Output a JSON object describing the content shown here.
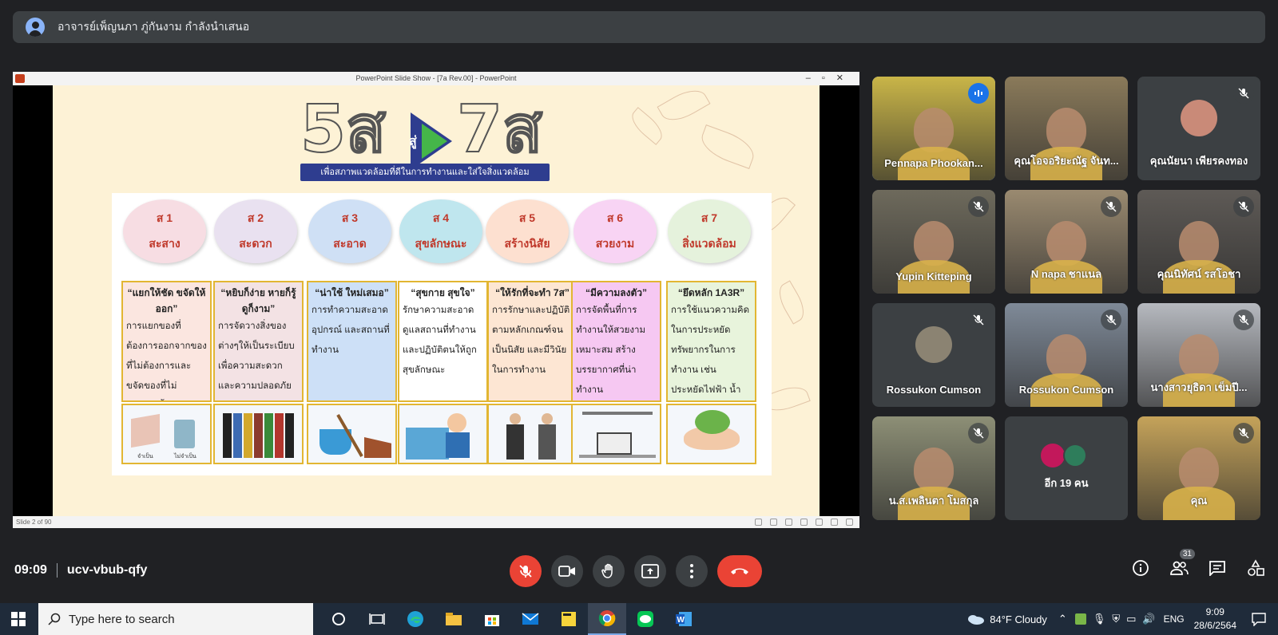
{
  "banner": {
    "text": "อาจารย์เพ็ญนภา ภู่กันงาม กำลังนำเสนอ"
  },
  "presentation": {
    "window_title": "PowerPoint Slide Show - [7a Rev.00] - PowerPoint",
    "status": "Slide 2 of 90",
    "slide": {
      "logo_left": "5ส",
      "logo_mid": "สู่",
      "logo_right": "7ส",
      "subtitle": "เพื่อสภาพแวดล้อมที่ดีในการทำงานและใส่ใจสิ่งแวดล้อม",
      "items": [
        {
          "num": "ส 1",
          "name": "สะสาง",
          "head": "“แยกให้ชัด ขจัดให้ออก”",
          "body": "การแยกของที่ต้องการออกจากของที่ไม่ต้องการและขจัดของที่ไม่ต้องการทิ้ง",
          "color": "#f7dde3",
          "cell": "#fbe6e0"
        },
        {
          "num": "ส 2",
          "name": "สะดวก",
          "head": "“หยิบก็ง่าย หายก็รู้ ดูก็งาม”",
          "body": "การจัดวางสิ่งของต่างๆให้เป็นระเบียบ เพื่อความสะดวกและความปลอดภัย",
          "color": "#e9e1f0",
          "cell": "#f3e2e4"
        },
        {
          "num": "ส 3",
          "name": "สะอาด",
          "head": "“น่าใช้ ใหม่เสมอ”",
          "body": "การทำความสะอาดอุปกรณ์ และสถานที่ทำงาน",
          "color": "#cfe0f5",
          "cell": "#cde0f7"
        },
        {
          "num": "ส 4",
          "name": "สุขลักษณะ",
          "head": "“สุขกาย สุขใจ”",
          "body": "รักษาความสะอาดดูแลสถานที่ทำงานและปฏิบัติตนให้ถูกสุขลักษณะ",
          "color": "#bfe6ee",
          "cell": "#fff"
        },
        {
          "num": "ส 5",
          "name": "สร้างนิสัย",
          "head": "“ให้รักที่จะทำ 7ส”",
          "body": "การรักษาและปฏิบัติตามหลักเกณฑ์จนเป็นนิสัย และมีวินัยในการทำงาน",
          "color": "#fde0d0",
          "cell": "#fde6d3"
        },
        {
          "num": "ส 6",
          "name": "สวยงาม",
          "head": "“มีความลงตัว”",
          "body": "การจัดพื้นที่การทำงานให้สวยงาม เหมาะสม สร้างบรรยากาศที่น่าทำงาน",
          "color": "#f8d4f4",
          "cell": "#f6c8f2"
        },
        {
          "num": "ส 7",
          "name": "สิ่งแวดล้อม",
          "head": "“ยึดหลัก 1A3R”",
          "body": "การใช้แนวความคิดในการประหยัดทรัพยากรในการทำงาน เช่น ประหยัดไฟฟ้า น้ำ กระดาษ",
          "color": "#e5f2dc",
          "cell": "#e8f4dc"
        }
      ],
      "pictures": [
        "จำเป็น",
        "ไม่จำเป็น"
      ]
    }
  },
  "participants": [
    {
      "name": "Pennapa Phookan...",
      "type": "video",
      "speaking": true,
      "bg": "#c9b548"
    },
    {
      "name": "คุณโอจอริยะณัฐ จันท...",
      "type": "video",
      "bg": "#8a7a5a"
    },
    {
      "name": "คุณนัยนา เพียรคงทอง",
      "type": "avatar",
      "muted": true,
      "avatar_color": "#c98a78"
    },
    {
      "name": "Yupin Kitteping",
      "type": "video",
      "muted": true,
      "bg": "#6e6a5c"
    },
    {
      "name": "N napa ชาแนล",
      "type": "video",
      "muted": true,
      "bg": "#9a8a70"
    },
    {
      "name": "คุณนิทัศน์ รสโอชา",
      "type": "video",
      "muted": true,
      "bg": "#5e5a56"
    },
    {
      "name": "Rossukon Cumson",
      "type": "avatar",
      "muted": true,
      "avatar_color": "#8b8372"
    },
    {
      "name": "Rossukon Cumson",
      "type": "video",
      "muted": true,
      "bg": "#7f8a98"
    },
    {
      "name": "นางสาวยุธิดา เข็มปี...",
      "type": "video",
      "muted": true,
      "bg": "#b6b9bf"
    },
    {
      "name": "น.ส.เพลินตา โมสกุล",
      "type": "video",
      "muted": true,
      "bg": "#8d8f76"
    },
    {
      "name": "อีก 19 คน",
      "type": "more"
    },
    {
      "name": "คุณ",
      "type": "video",
      "muted": true,
      "bg": "#c5a35a"
    }
  ],
  "meeting": {
    "time": "09:09",
    "code": "ucv-vbub-qfy",
    "people_count": "31"
  },
  "taskbar": {
    "search_placeholder": "Type here to search",
    "weather": "84°F  Cloudy",
    "lang": "ENG",
    "clock_time": "9:09",
    "clock_date": "28/6/2564"
  },
  "colors": {
    "accent": "#8ab4f8",
    "end_call": "#ea4335",
    "surface": "#3c4043"
  }
}
